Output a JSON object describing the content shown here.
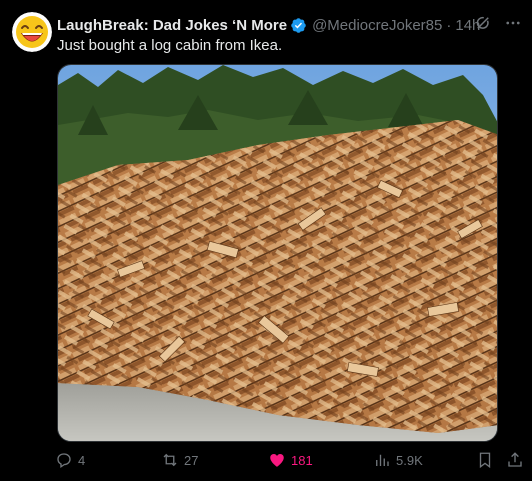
{
  "post": {
    "author_name": "LaughBreak: Dad Jokes ‘N More",
    "handle": "@MediocreJoker85",
    "separator": "·",
    "time": "14h",
    "text": "Just bought a log cabin from Ikea.",
    "verified": true
  },
  "icons": {
    "avatar": "laughing-face-emoji-avatar",
    "verified": "verified-badge-icon",
    "grok": "grok-icon",
    "more": "more-icon",
    "reply": "reply-icon",
    "repost": "repost-icon",
    "like": "heart-icon",
    "views": "views-icon",
    "bookmark": "bookmark-icon",
    "share": "share-icon"
  },
  "stats": {
    "replies": "4",
    "reposts": "27",
    "likes": "181",
    "views": "5.9K"
  },
  "colors": {
    "background": "#000000",
    "text": "#e7e9ea",
    "muted": "#71767b",
    "verified": "#1d9bf0",
    "like": "#f91880"
  }
}
